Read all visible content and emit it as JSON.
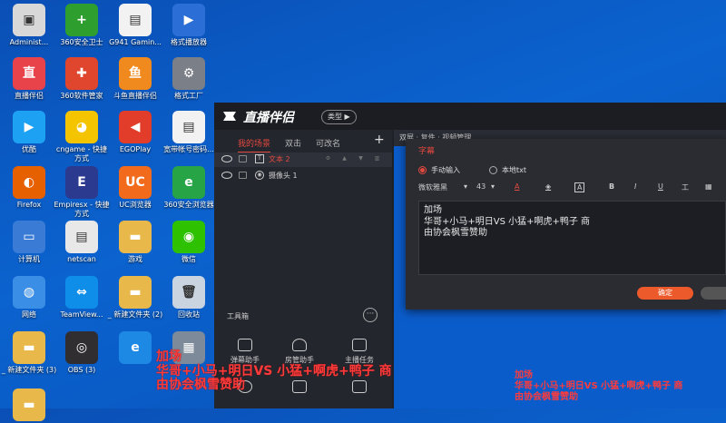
{
  "desktop": {
    "icons": [
      {
        "label": "Administ...",
        "color": "#d8d8d8",
        "glyph": "▣",
        "icon": "computer-icon"
      },
      {
        "label": "360安全卫士",
        "color": "#2e9e2e",
        "glyph": "+",
        "icon": "360-safe-icon"
      },
      {
        "label": "G941 Gamin...",
        "color": "#f2f2f2",
        "glyph": "▤",
        "icon": "file-icon"
      },
      {
        "label": "格式播放器",
        "color": "#2b6fd6",
        "glyph": "▶",
        "icon": "player-icon"
      },
      {
        "label": "直播伴侣",
        "color": "#e8434b",
        "glyph": "直",
        "icon": "live-companion-icon"
      },
      {
        "label": "360软件管家",
        "color": "#e0452e",
        "glyph": "✚",
        "icon": "360-software-icon"
      },
      {
        "label": "斗鱼直播伴侣",
        "color": "#f08a1e",
        "glyph": "鱼",
        "icon": "douyu-icon"
      },
      {
        "label": "格式工厂",
        "color": "#7a7f88",
        "glyph": "⚙",
        "icon": "format-factory-icon"
      },
      {
        "label": "优酷",
        "color": "#1da1f2",
        "glyph": "▶",
        "icon": "youku-icon"
      },
      {
        "label": "cngame - 快捷方式",
        "color": "#f5c400",
        "glyph": "◕",
        "icon": "pacman-icon"
      },
      {
        "label": "EGOPlay",
        "color": "#e23c2a",
        "glyph": "◀",
        "icon": "egoplay-icon"
      },
      {
        "label": "宽带帐号密码...",
        "color": "#f2f2f2",
        "glyph": "▤",
        "icon": "text-file-icon"
      },
      {
        "label": "Firefox",
        "color": "#e66000",
        "glyph": "◐",
        "icon": "firefox-icon"
      },
      {
        "label": "Empiresx - 快捷方式",
        "color": "#2b3a8f",
        "glyph": "E",
        "icon": "empires-icon"
      },
      {
        "label": "UC浏览器",
        "color": "#f26b1d",
        "glyph": "UC",
        "icon": "uc-browser-icon"
      },
      {
        "label": "360安全浏览器",
        "color": "#27a446",
        "glyph": "e",
        "icon": "360-browser-icon"
      },
      {
        "label": "计算机",
        "color": "#3a7bd5",
        "glyph": "▭",
        "icon": "monitor-icon"
      },
      {
        "label": "netscan",
        "color": "#e8e8e8",
        "glyph": "▤",
        "icon": "netscan-icon"
      },
      {
        "label": "游戏",
        "color": "#e8b84a",
        "glyph": "▬",
        "icon": "folder-icon"
      },
      {
        "label": "微信",
        "color": "#2dc100",
        "glyph": "◉",
        "icon": "wechat-icon"
      },
      {
        "label": "网络",
        "color": "#3a8ee6",
        "glyph": "◍",
        "icon": "network-icon"
      },
      {
        "label": "TeamView...",
        "color": "#0e8ee9",
        "glyph": "⇔",
        "icon": "teamviewer-icon"
      },
      {
        "label": "_ 新建文件夹 (2)",
        "color": "#e8b84a",
        "glyph": "▬",
        "icon": "zip-folder-icon"
      },
      {
        "label": "回收站",
        "color": "#c9d4e0",
        "glyph": "🗑",
        "icon": "recycle-bin-icon"
      },
      {
        "label": "_ 新建文件夹 (3)",
        "color": "#e8b84a",
        "glyph": "▬",
        "icon": "zip-folder-icon"
      },
      {
        "label": "OBS (3)",
        "color": "#302e31",
        "glyph": "◎",
        "icon": "obs-icon"
      },
      {
        "label": "",
        "color": "#1e88e5",
        "glyph": "e",
        "icon": "ie-icon"
      },
      {
        "label": "",
        "color": "#7d8a99",
        "glyph": "▦",
        "icon": "computer-icon"
      },
      {
        "label": "",
        "color": "#e8b84a",
        "glyph": "▬",
        "icon": "folder-icon"
      }
    ]
  },
  "app": {
    "title": "直播伴侣",
    "badge": "类型 ▶",
    "scene_tabs": [
      "我的场景",
      "双击",
      "可改名"
    ],
    "add_scene": "+",
    "sources": [
      {
        "name": "文本 2",
        "type": "T"
      },
      {
        "name": "摄像头 1",
        "type": "◉"
      }
    ],
    "toolbox_label": "工具箱",
    "toolbox_more": "···",
    "tools": [
      "弹幕助手",
      "房管助手",
      "主播任务"
    ],
    "preview_top": "双屏 · 复件 · 视频管理"
  },
  "dialog": {
    "title": "字幕",
    "mode_manual": "手动输入",
    "mode_local": "本地txt",
    "font": "微软雅黑",
    "font_size": "43",
    "format_icons": [
      "A",
      "B",
      "I",
      "U",
      "工",
      "▦"
    ],
    "text": "加场\n华哥+小马+明日VS 小猛+啊虎+鸭子 商\n由协会枫雪赞助",
    "ok": "确定"
  },
  "overlay": {
    "text": "加场\n华哥+小马+明日VS 小猛+啊虎+鸭子 商\n由协会枫雪赞助"
  },
  "colors": {
    "accent": "#e4493f",
    "confirm": "#ec5a2b",
    "subtitle": "#ff3b3b"
  }
}
